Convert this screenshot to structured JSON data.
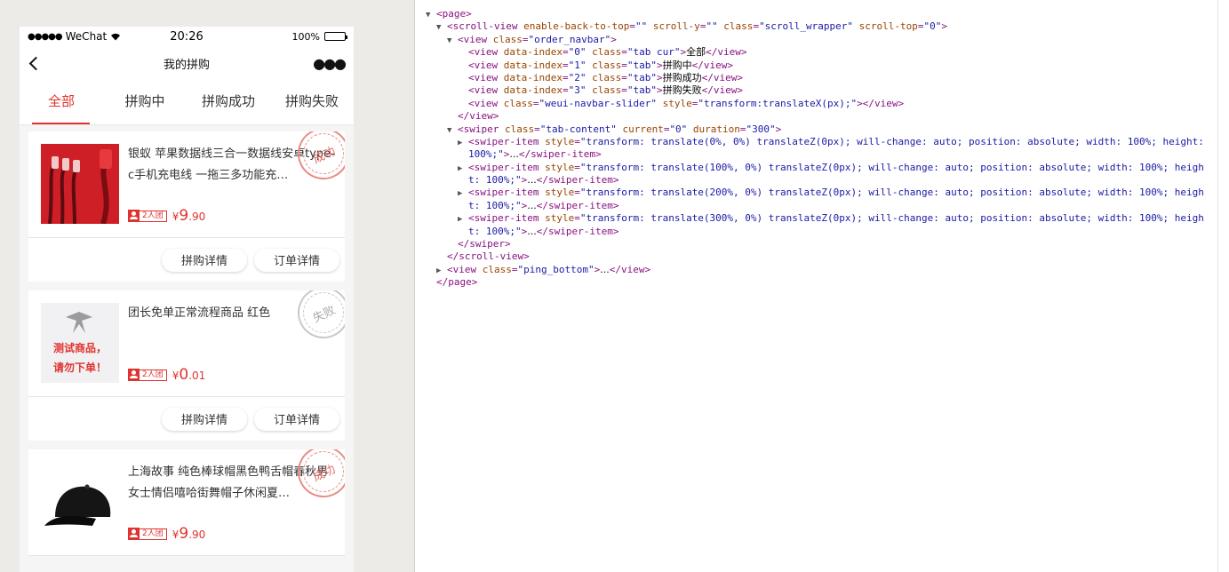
{
  "statusbar": {
    "carrier": "WeChat",
    "time": "20:26",
    "battery": "100%"
  },
  "navbar": {
    "title": "我的拼购"
  },
  "tabs": [
    {
      "label": "全部",
      "active": true
    },
    {
      "label": "拼购中",
      "active": false
    },
    {
      "label": "拼购成功",
      "active": false
    },
    {
      "label": "拼购失败",
      "active": false
    }
  ],
  "orders": [
    {
      "name": "银蚁 苹果数据线三合一数据线安卓type-c手机充电线 一拖三多功能充…",
      "team": "2人团",
      "currency": "¥",
      "price_int": "9",
      "price_dec": ".90",
      "stamp": "成功",
      "image": "cable-image",
      "btn_group": "拼购详情",
      "btn_order": "订单详情"
    },
    {
      "name": "团长免单正常流程商品 红色",
      "team": "2人团",
      "currency": "¥",
      "price_int": "0",
      "price_dec": ".01",
      "stamp": "失败",
      "image": "test-product-image",
      "image_text": [
        "测试商品，",
        "请勿下单！"
      ],
      "btn_group": "拼购详情",
      "btn_order": "订单详情"
    },
    {
      "name": "上海故事 纯色棒球帽黑色鸭舌帽春秋男女士情侣嘻哈街舞帽子休闲夏…",
      "team": "2人团",
      "currency": "¥",
      "price_int": "9",
      "price_dec": ".90",
      "stamp": "成功",
      "image": "cap-image"
    }
  ],
  "devtools": {
    "lines": [
      {
        "indent": 0,
        "tri": "▼",
        "parts": [
          [
            "tg",
            "<page>"
          ]
        ]
      },
      {
        "indent": 1,
        "tri": "▼",
        "parts": [
          [
            "tg",
            "<scroll-view"
          ],
          [
            "an",
            " enable-back-to-top"
          ],
          [
            "tg",
            "="
          ],
          [
            "av",
            "\"\""
          ],
          [
            "an",
            " scroll-y"
          ],
          [
            "tg",
            "="
          ],
          [
            "av",
            "\"\""
          ],
          [
            "an",
            " class"
          ],
          [
            "tg",
            "="
          ],
          [
            "av",
            "\"scroll_wrapper\""
          ],
          [
            "an",
            " scroll-top"
          ],
          [
            "tg",
            "="
          ],
          [
            "av",
            "\"0\""
          ],
          [
            "tg",
            ">"
          ]
        ]
      },
      {
        "indent": 2,
        "tri": "▼",
        "parts": [
          [
            "tg",
            "<view"
          ],
          [
            "an",
            " class"
          ],
          [
            "tg",
            "="
          ],
          [
            "av",
            "\"order_navbar\""
          ],
          [
            "tg",
            ">"
          ]
        ]
      },
      {
        "indent": 3,
        "tri": "",
        "parts": [
          [
            "tg",
            "<view"
          ],
          [
            "an",
            " data-index"
          ],
          [
            "tg",
            "="
          ],
          [
            "av",
            "\"0\""
          ],
          [
            "an",
            " class"
          ],
          [
            "tg",
            "="
          ],
          [
            "av",
            "\"tab cur\""
          ],
          [
            "tg",
            ">"
          ],
          [
            "tx",
            "全部"
          ],
          [
            "tg",
            "</view>"
          ]
        ]
      },
      {
        "indent": 3,
        "tri": "",
        "parts": [
          [
            "tg",
            "<view"
          ],
          [
            "an",
            " data-index"
          ],
          [
            "tg",
            "="
          ],
          [
            "av",
            "\"1\""
          ],
          [
            "an",
            " class"
          ],
          [
            "tg",
            "="
          ],
          [
            "av",
            "\"tab\""
          ],
          [
            "tg",
            ">"
          ],
          [
            "tx",
            "拼购中"
          ],
          [
            "tg",
            "</view>"
          ]
        ]
      },
      {
        "indent": 3,
        "tri": "",
        "parts": [
          [
            "tg",
            "<view"
          ],
          [
            "an",
            " data-index"
          ],
          [
            "tg",
            "="
          ],
          [
            "av",
            "\"2\""
          ],
          [
            "an",
            " class"
          ],
          [
            "tg",
            "="
          ],
          [
            "av",
            "\"tab\""
          ],
          [
            "tg",
            ">"
          ],
          [
            "tx",
            "拼购成功"
          ],
          [
            "tg",
            "</view>"
          ]
        ]
      },
      {
        "indent": 3,
        "tri": "",
        "parts": [
          [
            "tg",
            "<view"
          ],
          [
            "an",
            " data-index"
          ],
          [
            "tg",
            "="
          ],
          [
            "av",
            "\"3\""
          ],
          [
            "an",
            " class"
          ],
          [
            "tg",
            "="
          ],
          [
            "av",
            "\"tab\""
          ],
          [
            "tg",
            ">"
          ],
          [
            "tx",
            "拼购失败"
          ],
          [
            "tg",
            "</view>"
          ]
        ]
      },
      {
        "indent": 3,
        "tri": "",
        "parts": [
          [
            "tg",
            "<view"
          ],
          [
            "an",
            " class"
          ],
          [
            "tg",
            "="
          ],
          [
            "av",
            "\"weui-navbar-slider\""
          ],
          [
            "an",
            " style"
          ],
          [
            "tg",
            "="
          ],
          [
            "av",
            "\"transform:translateX(px);\""
          ],
          [
            "tg",
            "></view>"
          ]
        ]
      },
      {
        "indent": 2,
        "tri": "",
        "parts": [
          [
            "tg",
            "</view>"
          ]
        ]
      },
      {
        "indent": 2,
        "tri": "▼",
        "parts": [
          [
            "tg",
            "<swiper"
          ],
          [
            "an",
            " class"
          ],
          [
            "tg",
            "="
          ],
          [
            "av",
            "\"tab-content\""
          ],
          [
            "an",
            " current"
          ],
          [
            "tg",
            "="
          ],
          [
            "av",
            "\"0\""
          ],
          [
            "an",
            " duration"
          ],
          [
            "tg",
            "="
          ],
          [
            "av",
            "\"300\""
          ],
          [
            "tg",
            ">"
          ]
        ]
      },
      {
        "indent": 3,
        "tri": "▶",
        "parts": [
          [
            "tg",
            "<swiper-item"
          ],
          [
            "an",
            " style"
          ],
          [
            "tg",
            "="
          ],
          [
            "av",
            "\"transform: translate(0%, 0%) translateZ(0px); will-change: auto; position: absolute; width: 100%; height:"
          ]
        ]
      },
      {
        "indent": 3,
        "tri": "",
        "parts": [
          [
            "av",
            "100%;\""
          ],
          [
            "tg",
            ">"
          ],
          [
            "tx",
            "..."
          ],
          [
            "tg",
            "</swiper-item>"
          ]
        ]
      },
      {
        "indent": 3,
        "tri": "▶",
        "parts": [
          [
            "tg",
            "<swiper-item"
          ],
          [
            "an",
            " style"
          ],
          [
            "tg",
            "="
          ],
          [
            "av",
            "\"transform: translate(100%, 0%) translateZ(0px); will-change: auto; position: absolute; width: 100%; heigh"
          ]
        ]
      },
      {
        "indent": 3,
        "tri": "",
        "parts": [
          [
            "av",
            "t: 100%;\""
          ],
          [
            "tg",
            ">"
          ],
          [
            "tx",
            "..."
          ],
          [
            "tg",
            "</swiper-item>"
          ]
        ]
      },
      {
        "indent": 3,
        "tri": "▶",
        "parts": [
          [
            "tg",
            "<swiper-item"
          ],
          [
            "an",
            " style"
          ],
          [
            "tg",
            "="
          ],
          [
            "av",
            "\"transform: translate(200%, 0%) translateZ(0px); will-change: auto; position: absolute; width: 100%; heigh"
          ]
        ]
      },
      {
        "indent": 3,
        "tri": "",
        "parts": [
          [
            "av",
            "t: 100%;\""
          ],
          [
            "tg",
            ">"
          ],
          [
            "tx",
            "..."
          ],
          [
            "tg",
            "</swiper-item>"
          ]
        ]
      },
      {
        "indent": 3,
        "tri": "▶",
        "parts": [
          [
            "tg",
            "<swiper-item"
          ],
          [
            "an",
            " style"
          ],
          [
            "tg",
            "="
          ],
          [
            "av",
            "\"transform: translate(300%, 0%) translateZ(0px); will-change: auto; position: absolute; width: 100%; heigh"
          ]
        ]
      },
      {
        "indent": 3,
        "tri": "",
        "parts": [
          [
            "av",
            "t: 100%;\""
          ],
          [
            "tg",
            ">"
          ],
          [
            "tx",
            "..."
          ],
          [
            "tg",
            "</swiper-item>"
          ]
        ]
      },
      {
        "indent": 2,
        "tri": "",
        "parts": [
          [
            "tg",
            "</swiper>"
          ]
        ]
      },
      {
        "indent": 1,
        "tri": "",
        "parts": [
          [
            "tg",
            "</scroll-view>"
          ]
        ]
      },
      {
        "indent": 1,
        "tri": "▶",
        "parts": [
          [
            "tg",
            "<view"
          ],
          [
            "an",
            " class"
          ],
          [
            "tg",
            "="
          ],
          [
            "av",
            "\"ping_bottom\""
          ],
          [
            "tg",
            ">"
          ],
          [
            "tx",
            "..."
          ],
          [
            "tg",
            "</view>"
          ]
        ]
      },
      {
        "indent": 0,
        "tri": "",
        "parts": [
          [
            "tg",
            "</page>"
          ]
        ]
      }
    ]
  }
}
